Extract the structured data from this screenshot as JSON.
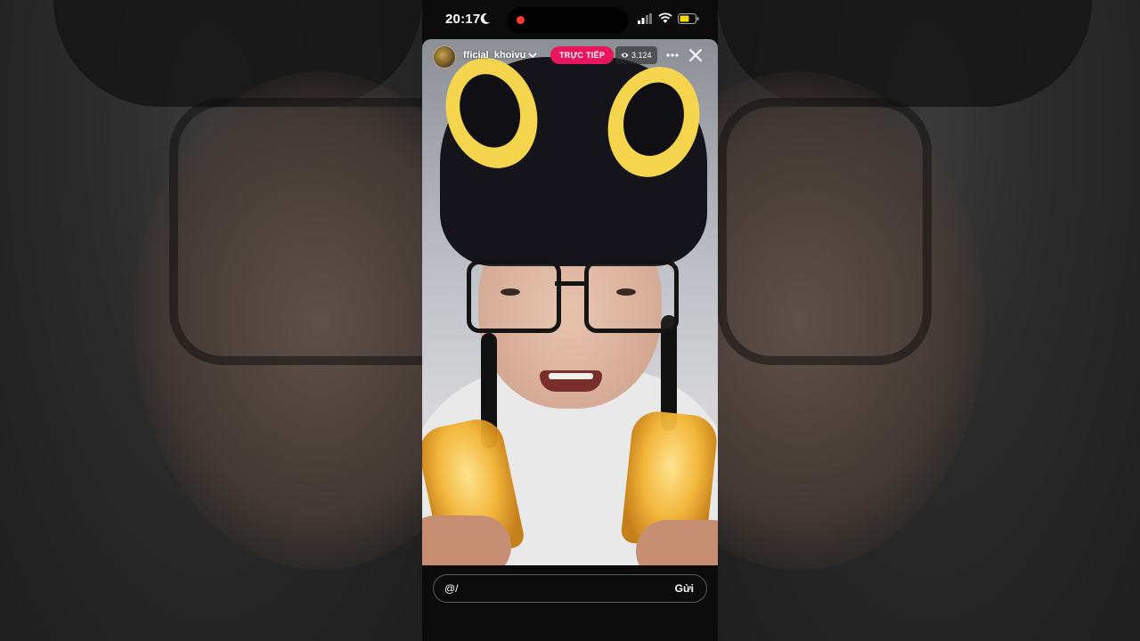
{
  "status_bar": {
    "time": "20:17"
  },
  "live": {
    "username": "fficial_khoivu",
    "live_label": "TRỰC TIẾP",
    "viewer_count": "3.124"
  },
  "comment": {
    "value": "@/",
    "send_label": "Gửi"
  },
  "colors": {
    "live_badge": "#e8175d",
    "battery_fill": "#f5d90a",
    "recording_dot": "#ff3b30"
  },
  "icons": [
    "moon-icon",
    "signal-icon",
    "wifi-icon",
    "battery-icon",
    "chevron-down-icon",
    "eye-icon",
    "more-icon",
    "close-icon"
  ]
}
